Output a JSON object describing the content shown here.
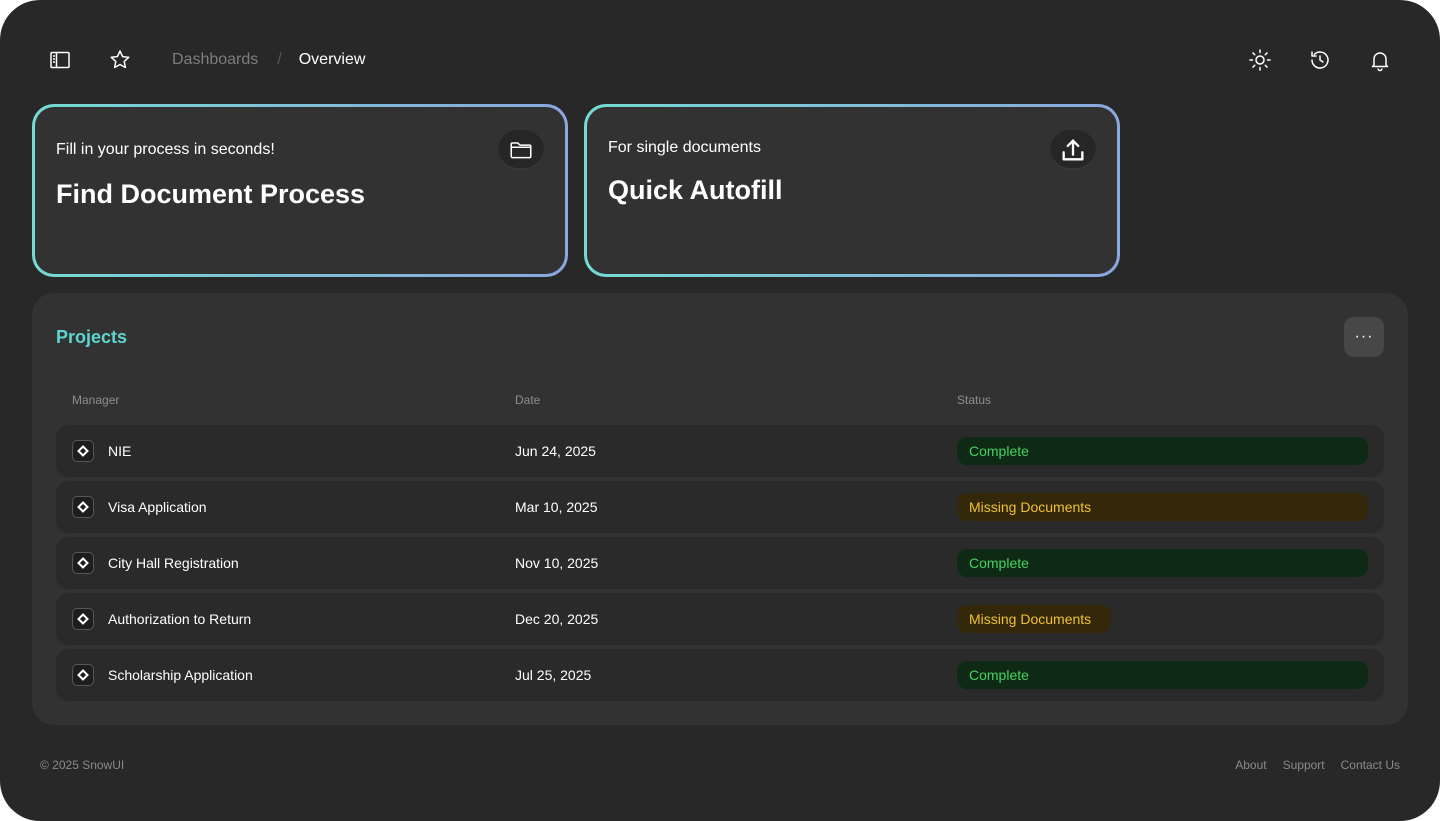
{
  "breadcrumb": {
    "parent": "Dashboards",
    "separator": "/",
    "current": "Overview"
  },
  "header_icons": [
    "sidebar-toggle-icon",
    "star-icon",
    "sun-icon",
    "history-icon",
    "bell-icon"
  ],
  "cards": [
    {
      "subtitle": "Fill in your process in seconds!",
      "title": "Find Document Process",
      "icon": "folder-icon"
    },
    {
      "subtitle": "For single documents",
      "title": "Quick Autofill",
      "icon": "upload-icon"
    }
  ],
  "projects": {
    "title": "Projects",
    "more_label": "···",
    "columns": {
      "manager": "Manager",
      "date": "Date",
      "status": "Status"
    },
    "rows": [
      {
        "manager": "NIE",
        "date": "Jun 24, 2025",
        "status": "Complete"
      },
      {
        "manager": "Visa Application",
        "date": "Mar 10, 2025",
        "status": "Missing Documents"
      },
      {
        "manager": "City Hall Registration",
        "date": "Nov 10, 2025",
        "status": "Complete"
      },
      {
        "manager": "Authorization to Return",
        "date": "Dec 20, 2025",
        "status": "Missing Documents"
      },
      {
        "manager": "Scholarship Application",
        "date": "Jul 25, 2025",
        "status": "Complete"
      }
    ]
  },
  "footer": {
    "copyright": "© 2025 SnowUI",
    "links": [
      "About",
      "Support",
      "Contact Us"
    ]
  },
  "colors": {
    "background": "#282828",
    "accent_teal": "#5fd5cf",
    "gradient_start": "#74dad2",
    "gradient_end": "#8aa7de",
    "status_complete": "#46d362",
    "status_missing": "#f2c230"
  }
}
